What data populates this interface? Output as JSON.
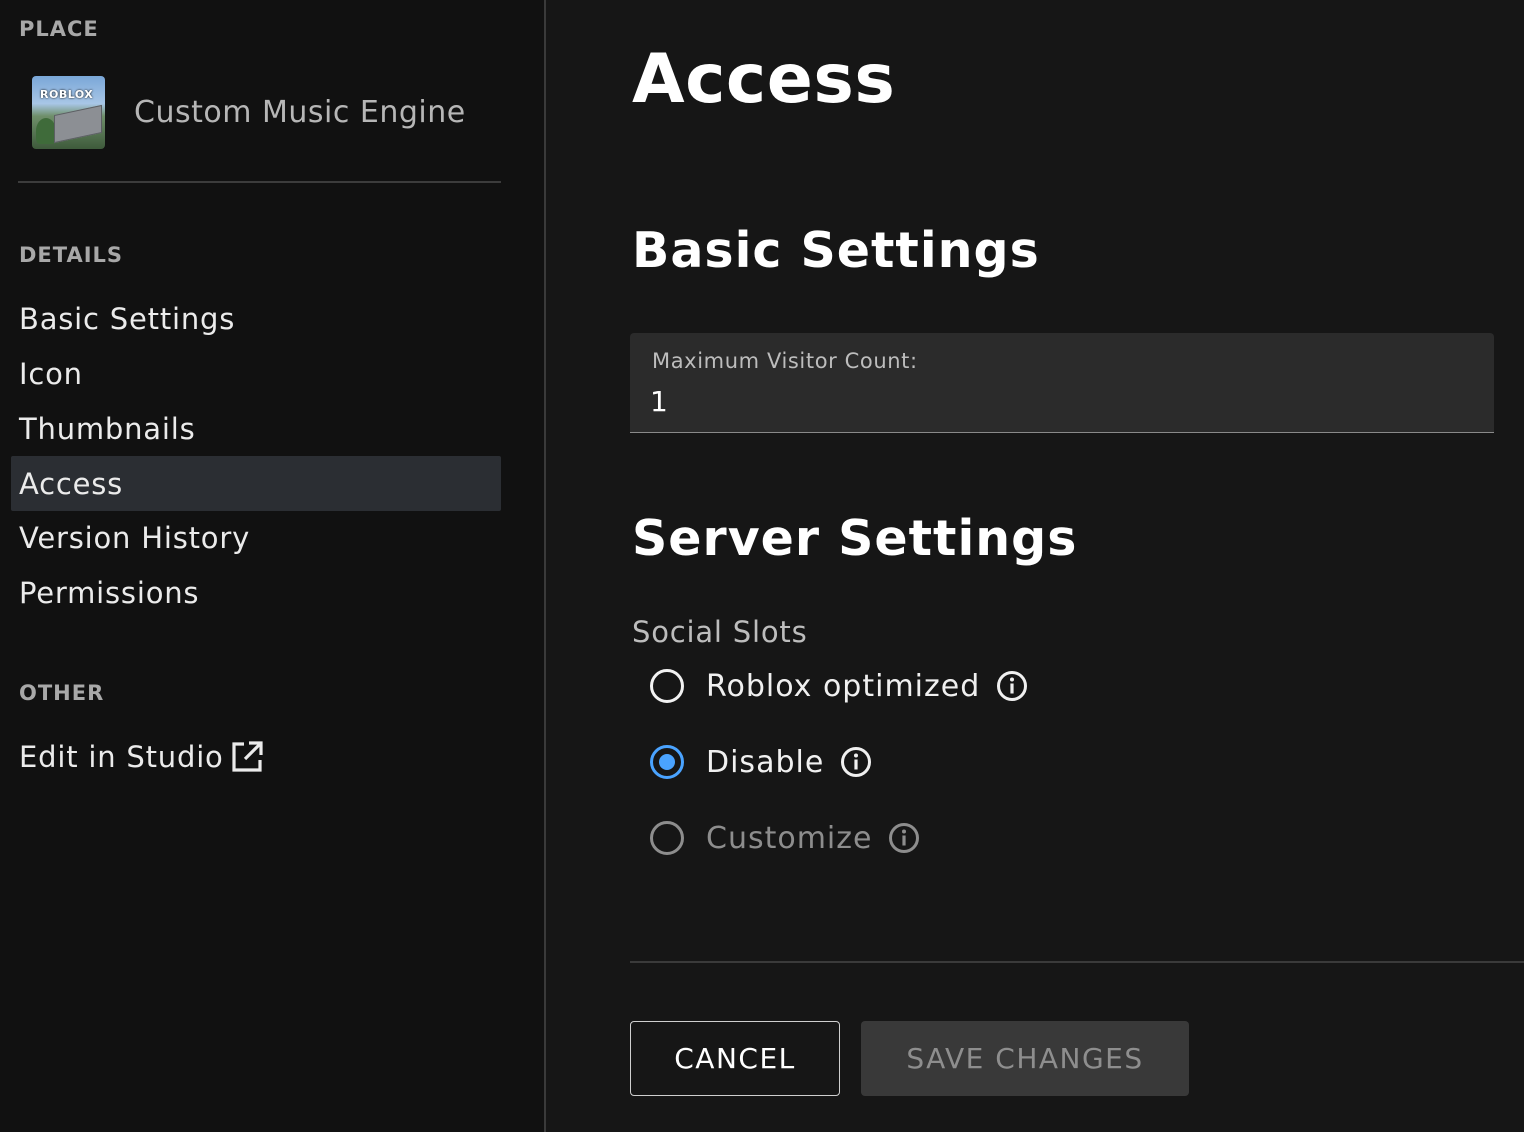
{
  "sidebar": {
    "place_section_label": "PLACE",
    "place_name": "Custom Music Engine",
    "place_thumb_logo": "ROBLOX",
    "details_section_label": "DETAILS",
    "items": [
      {
        "label": "Basic Settings"
      },
      {
        "label": "Icon"
      },
      {
        "label": "Thumbnails"
      },
      {
        "label": "Access",
        "active": true
      },
      {
        "label": "Version History"
      },
      {
        "label": "Permissions"
      }
    ],
    "other_section_label": "OTHER",
    "edit_in_studio_label": "Edit in Studio",
    "edit_in_studio_icon": "external-link-icon"
  },
  "main": {
    "page_title": "Access",
    "basic_settings_title": "Basic Settings",
    "max_visitor_label": "Maximum Visitor Count:",
    "max_visitor_value": "1",
    "server_settings_title": "Server Settings",
    "social_slots_label": "Social Slots",
    "social_slot_options": [
      {
        "label": "Roblox optimized",
        "selected": false,
        "disabled": false,
        "icon": "info-icon"
      },
      {
        "label": "Disable",
        "selected": true,
        "disabled": false,
        "icon": "info-icon"
      },
      {
        "label": "Customize",
        "selected": false,
        "disabled": true,
        "icon": "info-icon"
      }
    ],
    "cancel_label": "CANCEL",
    "save_label": "SAVE CHANGES"
  },
  "colors": {
    "background": "#161616",
    "sidebar_background": "#111111",
    "active_item": "#2b2e33",
    "accent": "#4aa3ff",
    "field_background": "#2b2b2b",
    "disabled_text": "#8d8d8d",
    "save_button_background": "#393939"
  }
}
